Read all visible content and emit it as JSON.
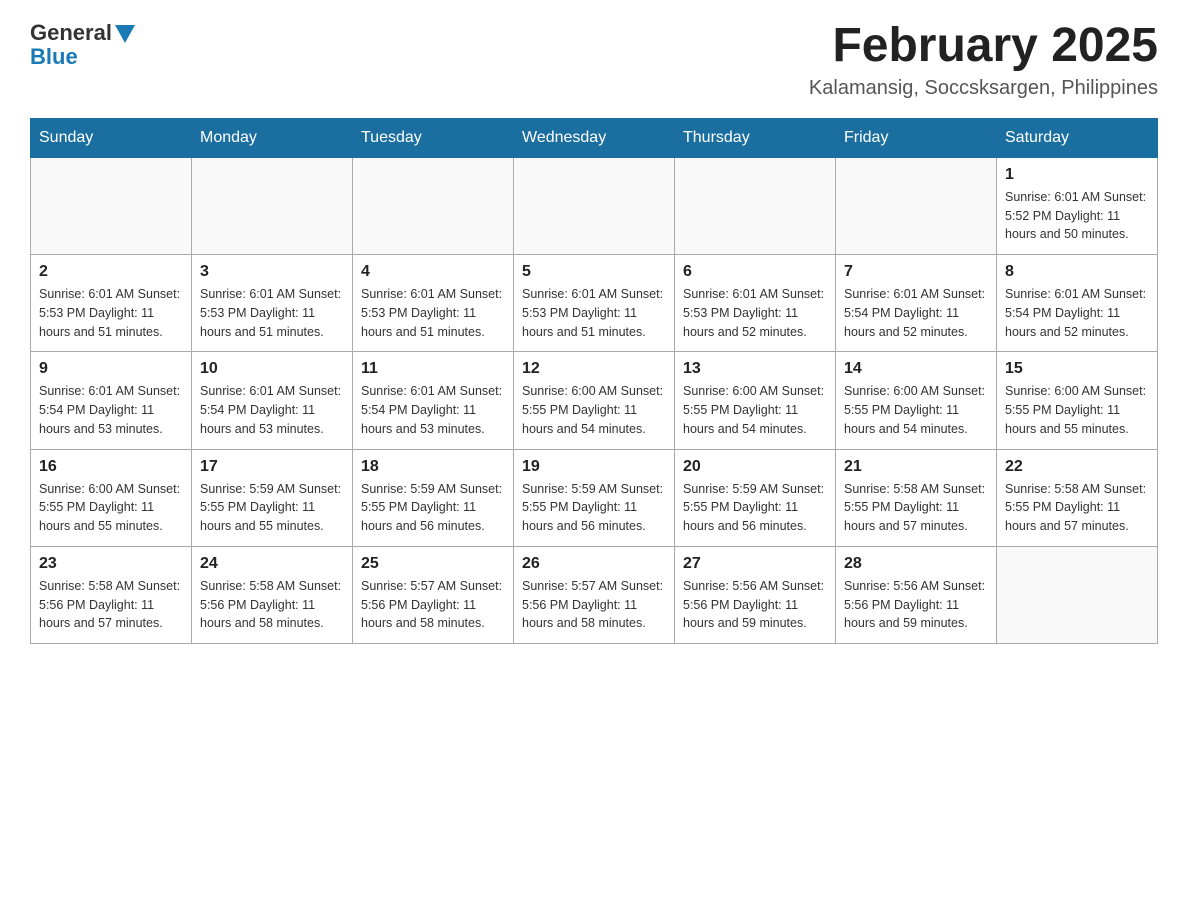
{
  "logo": {
    "general": "General",
    "blue": "Blue"
  },
  "title": "February 2025",
  "location": "Kalamansig, Soccsksargen, Philippines",
  "days_of_week": [
    "Sunday",
    "Monday",
    "Tuesday",
    "Wednesday",
    "Thursday",
    "Friday",
    "Saturday"
  ],
  "weeks": [
    [
      {
        "day": "",
        "info": ""
      },
      {
        "day": "",
        "info": ""
      },
      {
        "day": "",
        "info": ""
      },
      {
        "day": "",
        "info": ""
      },
      {
        "day": "",
        "info": ""
      },
      {
        "day": "",
        "info": ""
      },
      {
        "day": "1",
        "info": "Sunrise: 6:01 AM\nSunset: 5:52 PM\nDaylight: 11 hours and 50 minutes."
      }
    ],
    [
      {
        "day": "2",
        "info": "Sunrise: 6:01 AM\nSunset: 5:53 PM\nDaylight: 11 hours and 51 minutes."
      },
      {
        "day": "3",
        "info": "Sunrise: 6:01 AM\nSunset: 5:53 PM\nDaylight: 11 hours and 51 minutes."
      },
      {
        "day": "4",
        "info": "Sunrise: 6:01 AM\nSunset: 5:53 PM\nDaylight: 11 hours and 51 minutes."
      },
      {
        "day": "5",
        "info": "Sunrise: 6:01 AM\nSunset: 5:53 PM\nDaylight: 11 hours and 51 minutes."
      },
      {
        "day": "6",
        "info": "Sunrise: 6:01 AM\nSunset: 5:53 PM\nDaylight: 11 hours and 52 minutes."
      },
      {
        "day": "7",
        "info": "Sunrise: 6:01 AM\nSunset: 5:54 PM\nDaylight: 11 hours and 52 minutes."
      },
      {
        "day": "8",
        "info": "Sunrise: 6:01 AM\nSunset: 5:54 PM\nDaylight: 11 hours and 52 minutes."
      }
    ],
    [
      {
        "day": "9",
        "info": "Sunrise: 6:01 AM\nSunset: 5:54 PM\nDaylight: 11 hours and 53 minutes."
      },
      {
        "day": "10",
        "info": "Sunrise: 6:01 AM\nSunset: 5:54 PM\nDaylight: 11 hours and 53 minutes."
      },
      {
        "day": "11",
        "info": "Sunrise: 6:01 AM\nSunset: 5:54 PM\nDaylight: 11 hours and 53 minutes."
      },
      {
        "day": "12",
        "info": "Sunrise: 6:00 AM\nSunset: 5:55 PM\nDaylight: 11 hours and 54 minutes."
      },
      {
        "day": "13",
        "info": "Sunrise: 6:00 AM\nSunset: 5:55 PM\nDaylight: 11 hours and 54 minutes."
      },
      {
        "day": "14",
        "info": "Sunrise: 6:00 AM\nSunset: 5:55 PM\nDaylight: 11 hours and 54 minutes."
      },
      {
        "day": "15",
        "info": "Sunrise: 6:00 AM\nSunset: 5:55 PM\nDaylight: 11 hours and 55 minutes."
      }
    ],
    [
      {
        "day": "16",
        "info": "Sunrise: 6:00 AM\nSunset: 5:55 PM\nDaylight: 11 hours and 55 minutes."
      },
      {
        "day": "17",
        "info": "Sunrise: 5:59 AM\nSunset: 5:55 PM\nDaylight: 11 hours and 55 minutes."
      },
      {
        "day": "18",
        "info": "Sunrise: 5:59 AM\nSunset: 5:55 PM\nDaylight: 11 hours and 56 minutes."
      },
      {
        "day": "19",
        "info": "Sunrise: 5:59 AM\nSunset: 5:55 PM\nDaylight: 11 hours and 56 minutes."
      },
      {
        "day": "20",
        "info": "Sunrise: 5:59 AM\nSunset: 5:55 PM\nDaylight: 11 hours and 56 minutes."
      },
      {
        "day": "21",
        "info": "Sunrise: 5:58 AM\nSunset: 5:55 PM\nDaylight: 11 hours and 57 minutes."
      },
      {
        "day": "22",
        "info": "Sunrise: 5:58 AM\nSunset: 5:55 PM\nDaylight: 11 hours and 57 minutes."
      }
    ],
    [
      {
        "day": "23",
        "info": "Sunrise: 5:58 AM\nSunset: 5:56 PM\nDaylight: 11 hours and 57 minutes."
      },
      {
        "day": "24",
        "info": "Sunrise: 5:58 AM\nSunset: 5:56 PM\nDaylight: 11 hours and 58 minutes."
      },
      {
        "day": "25",
        "info": "Sunrise: 5:57 AM\nSunset: 5:56 PM\nDaylight: 11 hours and 58 minutes."
      },
      {
        "day": "26",
        "info": "Sunrise: 5:57 AM\nSunset: 5:56 PM\nDaylight: 11 hours and 58 minutes."
      },
      {
        "day": "27",
        "info": "Sunrise: 5:56 AM\nSunset: 5:56 PM\nDaylight: 11 hours and 59 minutes."
      },
      {
        "day": "28",
        "info": "Sunrise: 5:56 AM\nSunset: 5:56 PM\nDaylight: 11 hours and 59 minutes."
      },
      {
        "day": "",
        "info": ""
      }
    ]
  ]
}
